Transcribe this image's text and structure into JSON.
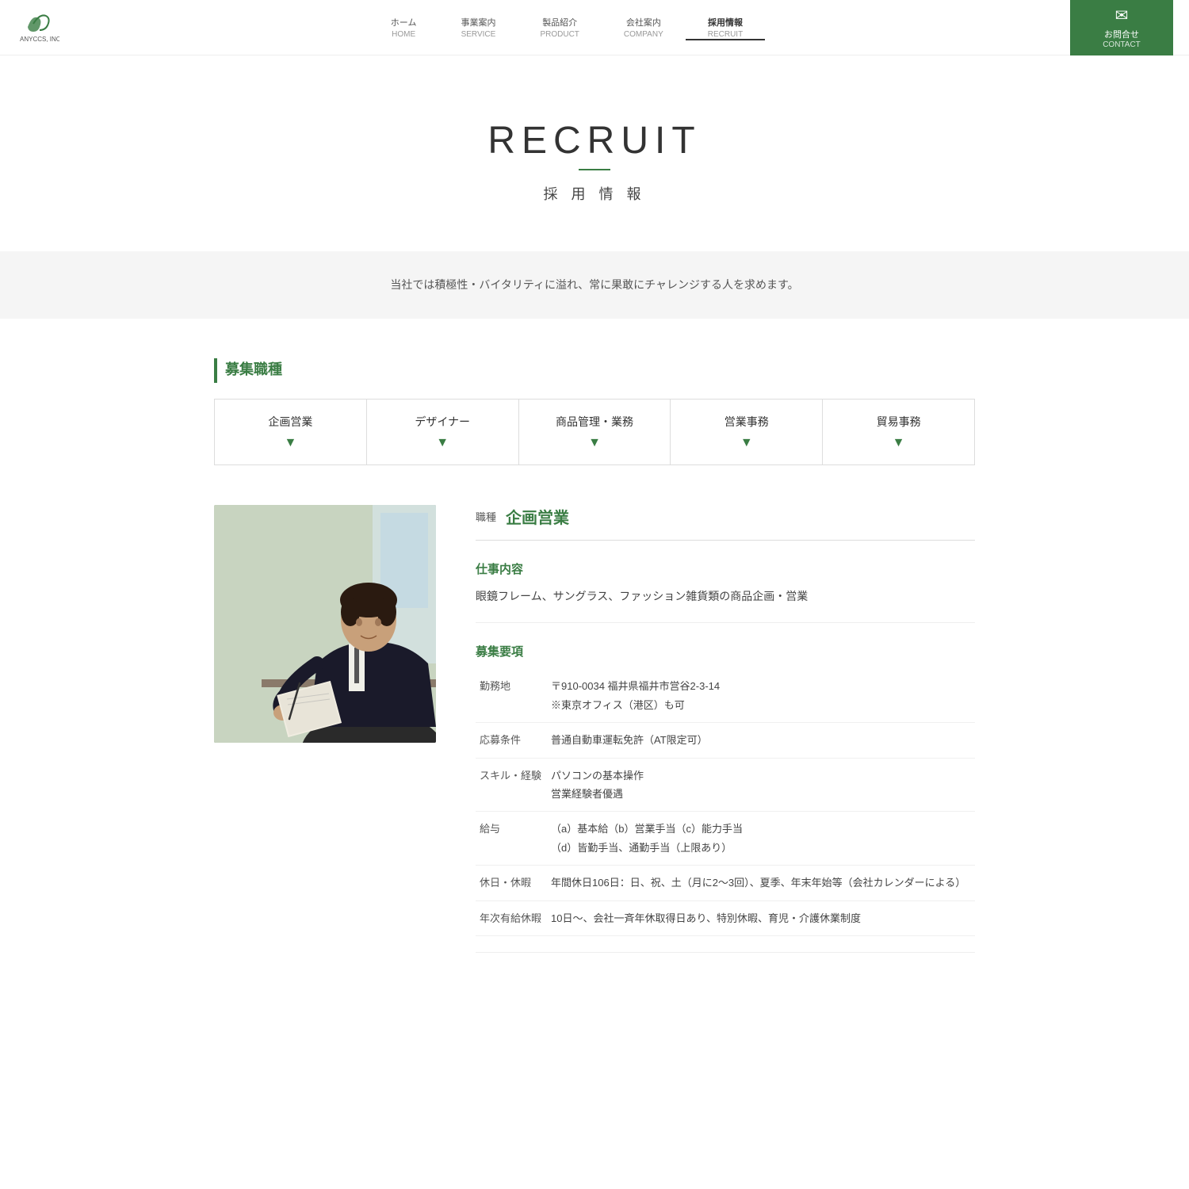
{
  "header": {
    "logo_alt": "ANYCCS, INC.",
    "nav": [
      {
        "ja": "ホーム",
        "en": "HOME",
        "active": false
      },
      {
        "ja": "事業案内",
        "en": "SERVICE",
        "active": false
      },
      {
        "ja": "製品紹介",
        "en": "PRODUCT",
        "active": false
      },
      {
        "ja": "会社案内",
        "en": "COMPANY",
        "active": false
      },
      {
        "ja": "採用情報",
        "en": "RECRUIT",
        "active": true
      }
    ],
    "contact": {
      "ja": "お問合せ",
      "en": "CONTACT"
    }
  },
  "hero": {
    "title_en": "RECRUIT",
    "title_ja": "採 用 情 報"
  },
  "banner": {
    "text": "当社では積極性・バイタリティに溢れ、常に果敢にチャレンジする人を求めます。"
  },
  "recruit": {
    "section_title": "募集職種",
    "tabs": [
      {
        "name": "企画営業"
      },
      {
        "name": "デザイナー"
      },
      {
        "name": "商品管理・業務"
      },
      {
        "name": "営業事務"
      },
      {
        "name": "貿易事務"
      }
    ],
    "job_detail": {
      "type_label": "職種",
      "type_name": "企画営業",
      "work_section": {
        "title": "仕事内容",
        "content": "眼鏡フレーム、サングラス、ファッション雑貨類の商品企画・営業"
      },
      "requirements_section": {
        "title": "募集要項",
        "rows": [
          {
            "label": "勤務地",
            "value": "〒910-0034 福井県福井市営谷2-3-14\n※東京オフィス（港区）も可"
          },
          {
            "label": "応募条件",
            "value": "普通自動車運転免許（AT限定可）"
          },
          {
            "label": "スキル・経験",
            "value": "パソコンの基本操作\n営業経験者優遇"
          },
          {
            "label": "給与",
            "value": "（a）基本給（b）営業手当（c）能力手当\n（d）皆勤手当、通勤手当（上限あり）"
          },
          {
            "label": "休日・休暇",
            "value": "年間休日106日：日、祝、土（月に2～3回）、夏季、年末年始等（会社カレンダーによる）"
          },
          {
            "label": "年次有給休暇",
            "value": "10日～、会社一斉年休取得日あり、特別休暇、育児・介護休業制度"
          }
        ]
      }
    }
  }
}
